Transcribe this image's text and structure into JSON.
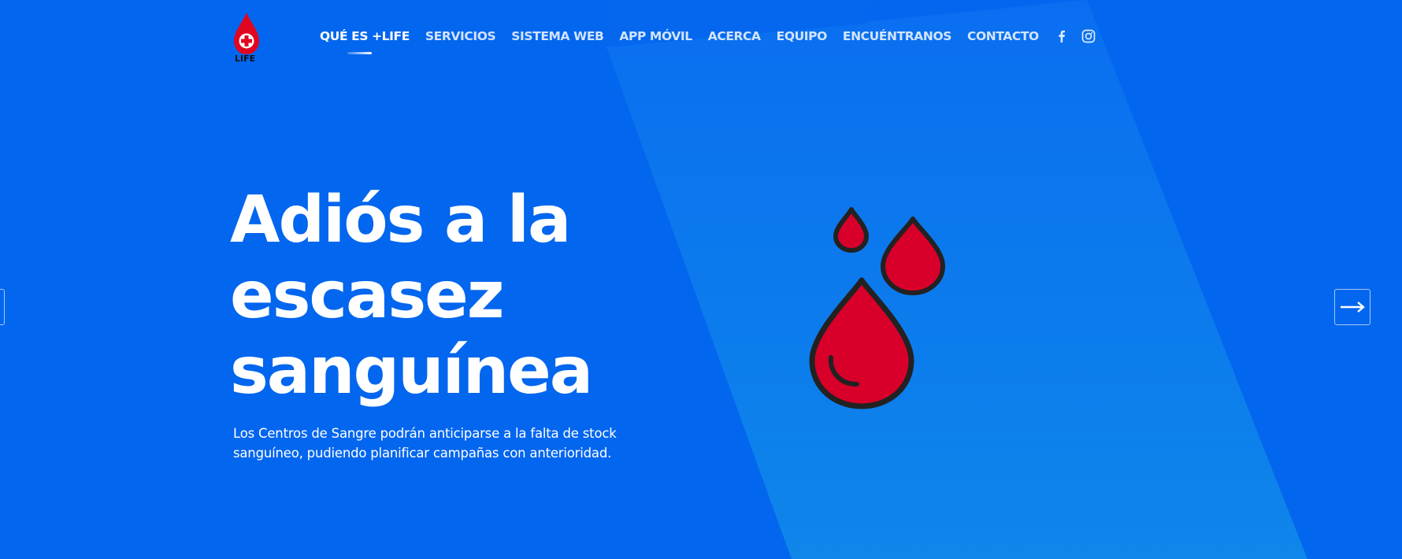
{
  "brand": {
    "logo_text": "LIFE",
    "primary_color": "#0366ef",
    "accent_color": "#d8002a"
  },
  "nav": {
    "items": [
      {
        "label": "QUÉ ES +LIFE",
        "active": true
      },
      {
        "label": "SERVICIOS",
        "active": false
      },
      {
        "label": "SISTEMA WEB",
        "active": false
      },
      {
        "label": "APP MÓVIL",
        "active": false
      },
      {
        "label": "ACERCA",
        "active": false
      },
      {
        "label": "EQUIPO",
        "active": false
      },
      {
        "label": "ENCUÉNTRANOS",
        "active": false
      },
      {
        "label": "CONTACTO",
        "active": false
      }
    ],
    "social": [
      "facebook-icon",
      "instagram-icon"
    ]
  },
  "hero": {
    "headline_lines": [
      "Adiós a la",
      "escasez",
      "sanguínea"
    ],
    "subtext_lines": [
      "Los Centros de Sangre podrán anticiparse a la falta de stock",
      "sanguíneo, pudiendo planificar campañas con anterioridad."
    ],
    "illustration": "blood-drops-icon"
  },
  "slider": {
    "next_icon": "arrow-right-icon",
    "prev_icon": "arrow-left-icon"
  }
}
